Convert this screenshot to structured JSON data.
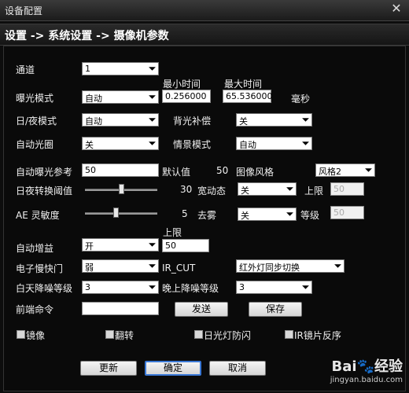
{
  "window": {
    "title": "设备配置",
    "close_glyph": "✕"
  },
  "header": {
    "breadcrumb": "设置 -> 系统设置 -> 摄像机参数"
  },
  "labels": {
    "channel": "通道",
    "exposure_mode": "曝光模式",
    "min_time": "最小时间",
    "max_time": "最大时间",
    "ms_unit": "毫秒",
    "day_night": "日/夜模式",
    "backlight": "背光补偿",
    "auto_iris": "自动光圈",
    "scene_mode": "情景模式",
    "ae_reference": "自动曝光参考",
    "default_value": "默认值",
    "image_style": "图像风格",
    "dn_threshold": "日夜转换阈值",
    "wide_dynamic": "宽动态",
    "upper_limit_1": "上限",
    "ae_sensitivity": "AE 灵敏度",
    "defog": "去雾",
    "level": "等级",
    "upper_limit_2": "上限",
    "auto_gain": "自动增益",
    "e_shutter": "电子慢快门",
    "ir_cut": "IR_CUT",
    "day_nr": "白天降噪等级",
    "night_nr": "晚上降噪等级",
    "front_cmd": "前端命令"
  },
  "values": {
    "channel": "1",
    "exposure_mode": "自动",
    "min_time": "0.256000",
    "max_time": "65.536000",
    "day_night": "自动",
    "backlight": "关",
    "auto_iris": "关",
    "scene_mode": "自动",
    "ae_reference": "50",
    "default_value_num": "50",
    "image_style": "风格2",
    "dn_threshold_num": "30",
    "wide_dynamic": "关",
    "wide_dynamic_limit": "50",
    "ae_sensitivity_num": "5",
    "defog": "关",
    "defog_level": "50",
    "auto_gain": "开",
    "gain_limit": "50",
    "e_shutter": "弱",
    "ir_cut": "红外灯同步切换",
    "day_nr": "3",
    "night_nr": "3",
    "front_cmd": ""
  },
  "sliders": {
    "dn_threshold": 0.5,
    "ae_sensitivity": 0.42
  },
  "buttons": {
    "send": "发送",
    "save": "保存",
    "refresh": "更新",
    "ok": "确定",
    "cancel": "取消"
  },
  "checkboxes": {
    "mirror": "镜像",
    "flip": "翻转",
    "anti_flicker": "日光灯防闪",
    "ir_reverse": "IR镜片反序"
  },
  "watermark": {
    "brand": "Bai",
    "brand2": "经验",
    "sub": "jingyan.baidu.com"
  }
}
